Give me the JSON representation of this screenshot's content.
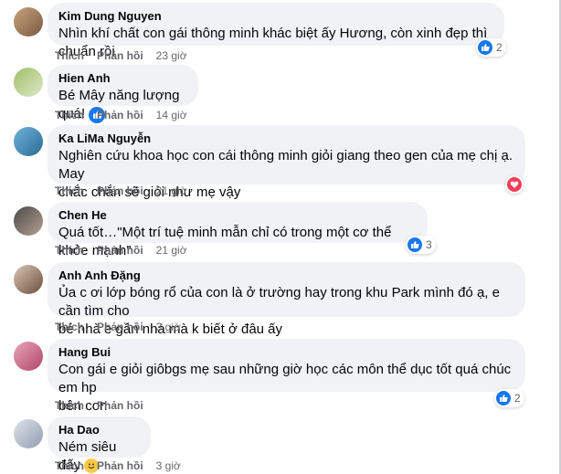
{
  "actions": {
    "like": "Thích",
    "reply": "Phản hồi"
  },
  "comments": [
    {
      "author": "Kim Dung Nguyen",
      "text": "Nhìn khí chất con gái thông minh khác biệt ấy Hương, còn xinh đẹp thì chuẩn rồi",
      "time": "23 giờ",
      "reaction": "like",
      "reaction_count": "2"
    },
    {
      "author": "Hien Anh",
      "text": "Bé Mây năng lượng quá!",
      "time": "14 giờ",
      "inline_emoji": "like"
    },
    {
      "author": "Ka LiMa Nguyễn",
      "text_lines": [
        "Nghiên cứu khoa học con cái thông minh giỏi giang theo gen của mẹ chị ạ. May",
        "chắc chắn sẽ giỏi như mẹ vậy"
      ],
      "time": "21 giờ",
      "reaction": "love"
    },
    {
      "author": "Chen He",
      "text": "Quá tốt…\"Một trí tuệ minh mẫn chỉ có trong một cơ thể khỏe mạnh\"",
      "time": "21 giờ",
      "reaction": "like",
      "reaction_count": "3"
    },
    {
      "author": "Anh Anh Đặng",
      "text_lines": [
        "Ủa c ơi lớp bóng rổ của con là ở trường hay trong khu Park mình đó ạ, e cần tìm cho",
        "bé nhà e gần nhà mà k biết ở đâu ấy"
      ],
      "time": "3 giờ"
    },
    {
      "author": "Hang Bui",
      "text_lines": [
        "Con gái e giỏi giôbgs mẹ sau những giờ học các môn thể dục tốt quá chúc em hp",
        "bên con"
      ],
      "time": "",
      "reaction": "like",
      "reaction_count": "2"
    },
    {
      "author": "Ha Dao",
      "text": "Ném siêu đấy",
      "time": "3 giờ",
      "inline_emoji": "smile"
    }
  ]
}
